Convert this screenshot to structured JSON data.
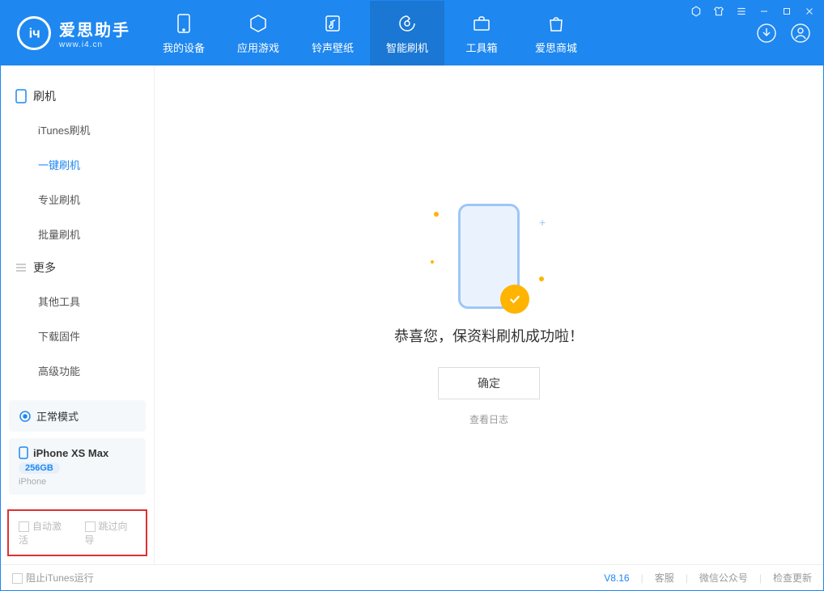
{
  "app": {
    "name": "爱思助手",
    "website": "www.i4.cn"
  },
  "nav": {
    "tabs": [
      {
        "label": "我的设备"
      },
      {
        "label": "应用游戏"
      },
      {
        "label": "铃声壁纸"
      },
      {
        "label": "智能刷机"
      },
      {
        "label": "工具箱"
      },
      {
        "label": "爱思商城"
      }
    ]
  },
  "sidebar": {
    "group1": {
      "title": "刷机",
      "items": [
        {
          "label": "iTunes刷机"
        },
        {
          "label": "一键刷机"
        },
        {
          "label": "专业刷机"
        },
        {
          "label": "批量刷机"
        }
      ]
    },
    "group2": {
      "title": "更多",
      "items": [
        {
          "label": "其他工具"
        },
        {
          "label": "下载固件"
        },
        {
          "label": "高级功能"
        }
      ]
    },
    "mode_card": {
      "label": "正常模式"
    },
    "device_card": {
      "name": "iPhone XS Max",
      "capacity": "256GB",
      "type": "iPhone"
    },
    "checkboxes": {
      "auto_activate": "自动激活",
      "skip_guide": "跳过向导"
    }
  },
  "main": {
    "success_text": "恭喜您，保资料刷机成功啦！",
    "ok_button": "确定",
    "view_log": "查看日志"
  },
  "statusbar": {
    "block_itunes": "阻止iTunes运行",
    "version": "V8.16",
    "support": "客服",
    "wechat": "微信公众号",
    "update": "检查更新"
  }
}
